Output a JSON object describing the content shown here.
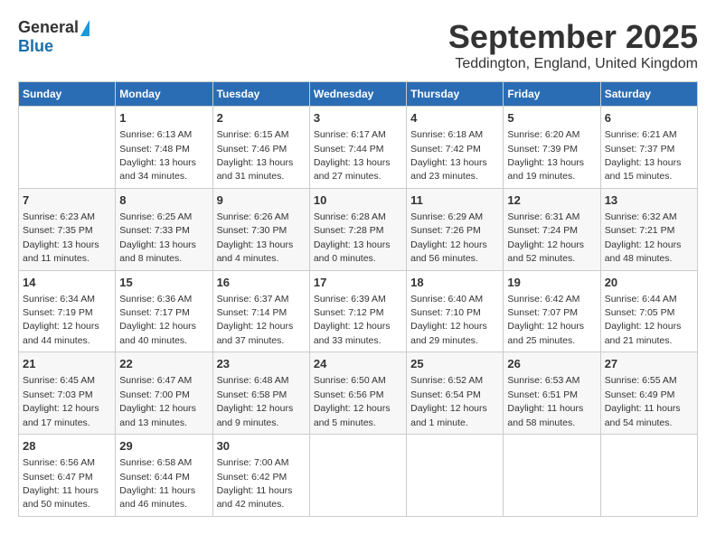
{
  "header": {
    "logo_general": "General",
    "logo_blue": "Blue",
    "month_title": "September 2025",
    "location": "Teddington, England, United Kingdom"
  },
  "days_of_week": [
    "Sunday",
    "Monday",
    "Tuesday",
    "Wednesday",
    "Thursday",
    "Friday",
    "Saturday"
  ],
  "weeks": [
    [
      {
        "day": "",
        "content": ""
      },
      {
        "day": "1",
        "content": "Sunrise: 6:13 AM\nSunset: 7:48 PM\nDaylight: 13 hours\nand 34 minutes."
      },
      {
        "day": "2",
        "content": "Sunrise: 6:15 AM\nSunset: 7:46 PM\nDaylight: 13 hours\nand 31 minutes."
      },
      {
        "day": "3",
        "content": "Sunrise: 6:17 AM\nSunset: 7:44 PM\nDaylight: 13 hours\nand 27 minutes."
      },
      {
        "day": "4",
        "content": "Sunrise: 6:18 AM\nSunset: 7:42 PM\nDaylight: 13 hours\nand 23 minutes."
      },
      {
        "day": "5",
        "content": "Sunrise: 6:20 AM\nSunset: 7:39 PM\nDaylight: 13 hours\nand 19 minutes."
      },
      {
        "day": "6",
        "content": "Sunrise: 6:21 AM\nSunset: 7:37 PM\nDaylight: 13 hours\nand 15 minutes."
      }
    ],
    [
      {
        "day": "7",
        "content": "Sunrise: 6:23 AM\nSunset: 7:35 PM\nDaylight: 13 hours\nand 11 minutes."
      },
      {
        "day": "8",
        "content": "Sunrise: 6:25 AM\nSunset: 7:33 PM\nDaylight: 13 hours\nand 8 minutes."
      },
      {
        "day": "9",
        "content": "Sunrise: 6:26 AM\nSunset: 7:30 PM\nDaylight: 13 hours\nand 4 minutes."
      },
      {
        "day": "10",
        "content": "Sunrise: 6:28 AM\nSunset: 7:28 PM\nDaylight: 13 hours\nand 0 minutes."
      },
      {
        "day": "11",
        "content": "Sunrise: 6:29 AM\nSunset: 7:26 PM\nDaylight: 12 hours\nand 56 minutes."
      },
      {
        "day": "12",
        "content": "Sunrise: 6:31 AM\nSunset: 7:24 PM\nDaylight: 12 hours\nand 52 minutes."
      },
      {
        "day": "13",
        "content": "Sunrise: 6:32 AM\nSunset: 7:21 PM\nDaylight: 12 hours\nand 48 minutes."
      }
    ],
    [
      {
        "day": "14",
        "content": "Sunrise: 6:34 AM\nSunset: 7:19 PM\nDaylight: 12 hours\nand 44 minutes."
      },
      {
        "day": "15",
        "content": "Sunrise: 6:36 AM\nSunset: 7:17 PM\nDaylight: 12 hours\nand 40 minutes."
      },
      {
        "day": "16",
        "content": "Sunrise: 6:37 AM\nSunset: 7:14 PM\nDaylight: 12 hours\nand 37 minutes."
      },
      {
        "day": "17",
        "content": "Sunrise: 6:39 AM\nSunset: 7:12 PM\nDaylight: 12 hours\nand 33 minutes."
      },
      {
        "day": "18",
        "content": "Sunrise: 6:40 AM\nSunset: 7:10 PM\nDaylight: 12 hours\nand 29 minutes."
      },
      {
        "day": "19",
        "content": "Sunrise: 6:42 AM\nSunset: 7:07 PM\nDaylight: 12 hours\nand 25 minutes."
      },
      {
        "day": "20",
        "content": "Sunrise: 6:44 AM\nSunset: 7:05 PM\nDaylight: 12 hours\nand 21 minutes."
      }
    ],
    [
      {
        "day": "21",
        "content": "Sunrise: 6:45 AM\nSunset: 7:03 PM\nDaylight: 12 hours\nand 17 minutes."
      },
      {
        "day": "22",
        "content": "Sunrise: 6:47 AM\nSunset: 7:00 PM\nDaylight: 12 hours\nand 13 minutes."
      },
      {
        "day": "23",
        "content": "Sunrise: 6:48 AM\nSunset: 6:58 PM\nDaylight: 12 hours\nand 9 minutes."
      },
      {
        "day": "24",
        "content": "Sunrise: 6:50 AM\nSunset: 6:56 PM\nDaylight: 12 hours\nand 5 minutes."
      },
      {
        "day": "25",
        "content": "Sunrise: 6:52 AM\nSunset: 6:54 PM\nDaylight: 12 hours\nand 1 minute."
      },
      {
        "day": "26",
        "content": "Sunrise: 6:53 AM\nSunset: 6:51 PM\nDaylight: 11 hours\nand 58 minutes."
      },
      {
        "day": "27",
        "content": "Sunrise: 6:55 AM\nSunset: 6:49 PM\nDaylight: 11 hours\nand 54 minutes."
      }
    ],
    [
      {
        "day": "28",
        "content": "Sunrise: 6:56 AM\nSunset: 6:47 PM\nDaylight: 11 hours\nand 50 minutes."
      },
      {
        "day": "29",
        "content": "Sunrise: 6:58 AM\nSunset: 6:44 PM\nDaylight: 11 hours\nand 46 minutes."
      },
      {
        "day": "30",
        "content": "Sunrise: 7:00 AM\nSunset: 6:42 PM\nDaylight: 11 hours\nand 42 minutes."
      },
      {
        "day": "",
        "content": ""
      },
      {
        "day": "",
        "content": ""
      },
      {
        "day": "",
        "content": ""
      },
      {
        "day": "",
        "content": ""
      }
    ]
  ]
}
